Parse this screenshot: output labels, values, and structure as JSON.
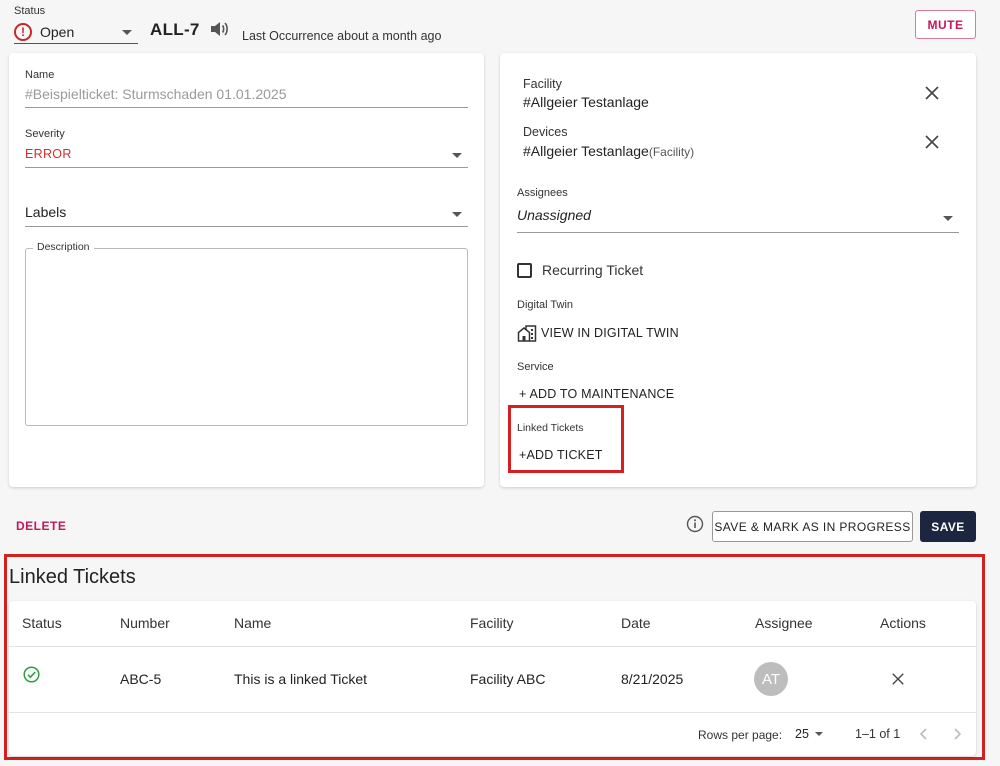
{
  "header": {
    "status_label": "Status",
    "status_value": "Open",
    "ticket_id": "ALL-7",
    "last_occurrence": "Last Occurrence about a month ago",
    "mute_label": "MUTE"
  },
  "left_panel": {
    "name_label": "Name",
    "name_value": "#Beispielticket: Sturmschaden 01.01.2025",
    "severity_label": "Severity",
    "severity_value": "ERROR",
    "labels_label": "Labels",
    "description_label": "Description",
    "description_value": ""
  },
  "right_panel": {
    "facility_label": "Facility",
    "facility_value": "#Allgeier Testanlage",
    "devices_label": "Devices",
    "devices_value": "#Allgeier Testanlage",
    "devices_sub": "(Facility)",
    "assignees_label": "Assignees",
    "assignees_value": "Unassigned",
    "recurring_label": "Recurring Ticket",
    "recurring_checked": false,
    "digital_twin_label": "Digital Twin",
    "digital_twin_button": "VIEW IN DIGITAL TWIN",
    "service_label": "Service",
    "service_button": "+ ADD TO MAINTENANCE",
    "linked_tickets_label": "Linked Tickets",
    "linked_tickets_button": "+ADD TICKET"
  },
  "actions": {
    "delete_label": "DELETE",
    "save_progress_label": "SAVE & MARK AS IN PROGRESS",
    "save_label": "SAVE"
  },
  "linked_tickets": {
    "title": "Linked Tickets",
    "columns": [
      "Status",
      "Number",
      "Name",
      "Facility",
      "Date",
      "Assignee",
      "Actions"
    ],
    "rows": [
      {
        "status": "done",
        "number": "ABC-5",
        "name": "This is a linked Ticket",
        "facility": "Facility ABC",
        "date": "8/21/2025",
        "assignee_initials": "AT"
      }
    ],
    "rows_per_page_label": "Rows per page:",
    "rows_per_page_value": "25",
    "page_range": "1–1 of 1"
  },
  "colors": {
    "accent_pink": "#c2185b",
    "error_red": "#d32f2f",
    "highlight_red": "#d32020",
    "save_button_bg": "#1d2640",
    "success_green": "#2e9e3e"
  }
}
